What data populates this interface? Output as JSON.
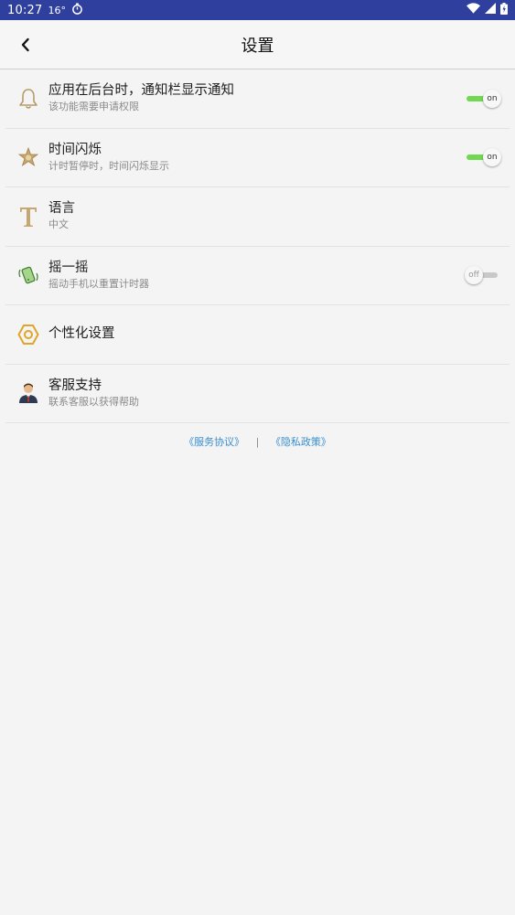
{
  "status_bar": {
    "time": "10:27",
    "temp": "16°",
    "bg_color": "#2f3f9e"
  },
  "header": {
    "title": "设置"
  },
  "settings": [
    {
      "label": "应用在后台时，通知栏显示通知",
      "sublabel": "该功能需要申请权限",
      "icon": "bell-icon",
      "toggle": "on"
    },
    {
      "label": "时间闪烁",
      "sublabel": "计时暂停时，时间闪烁显示",
      "icon": "star-icon",
      "toggle": "on"
    },
    {
      "label": "语言",
      "sublabel": "中文",
      "icon": "text-t-icon"
    },
    {
      "label": "摇一摇",
      "sublabel": "摇动手机以重置计时器",
      "icon": "shake-phone-icon",
      "toggle": "off"
    },
    {
      "label": "个性化设置",
      "sublabel": "",
      "icon": "hexagon-icon"
    },
    {
      "label": "客服支持",
      "sublabel": "联系客服以获得帮助",
      "icon": "support-agent-icon"
    }
  ],
  "footer": {
    "service_agreement": "《服务协议》",
    "separator": "|",
    "privacy_policy": "《隐私政策》"
  },
  "colors": {
    "toggle_on": "#6fd94f",
    "toggle_off": "#c9c9c9",
    "link": "#3a8fcf",
    "icon_brown": "#b89a6a",
    "icon_gold": "#e0a52a"
  }
}
